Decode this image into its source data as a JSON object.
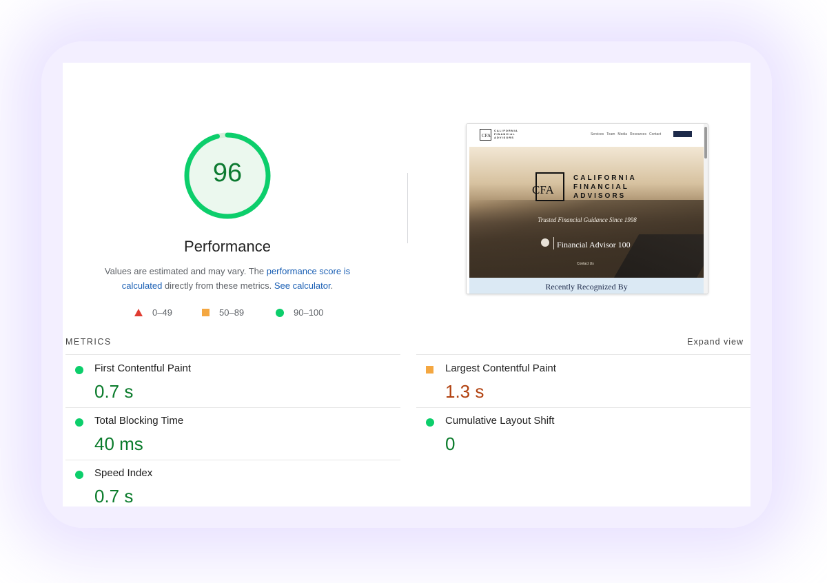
{
  "gauge": {
    "score": "96",
    "score_fraction": 0.96,
    "title": "Performance",
    "color": "#0cce6b"
  },
  "description": {
    "prefix": "Values are estimated and may vary. The ",
    "link1": "performance score is calculated",
    "middle": " directly from these metrics. ",
    "link2": "See calculator",
    "suffix": "."
  },
  "legend": [
    {
      "icon": "triangle-icon",
      "range": "0–49",
      "color": "#e03c31"
    },
    {
      "icon": "square-icon",
      "range": "50–89",
      "color": "#f4a741"
    },
    {
      "icon": "circle-icon",
      "range": "90–100",
      "color": "#0cce6b"
    }
  ],
  "thumbnail": {
    "logo_mark": "CFA",
    "logo_text": "CALIFORNIA\nFINANCIAL\nADVISORS",
    "menu": [
      "Services",
      "Team",
      "Media",
      "Resources",
      "Contact"
    ],
    "hero_logo_mark": "CFA",
    "hero_logo_line1": "CALIFORNIA",
    "hero_logo_line2": "FINANCIAL",
    "hero_logo_line3": "ADVISORS",
    "tagline": "Trusted Financial Guidance Since 1998",
    "award": "Financial Advisor 100",
    "contact": "Contact Us",
    "recognized": "Recently Recognized By"
  },
  "metrics": {
    "title": "METRICS",
    "expand_label": "Expand view",
    "items": [
      {
        "label": "First Contentful Paint",
        "value": "0.7 s",
        "rating": "good"
      },
      {
        "label": "Largest Contentful Paint",
        "value": "1.3 s",
        "rating": "average"
      },
      {
        "label": "Total Blocking Time",
        "value": "40 ms",
        "rating": "good"
      },
      {
        "label": "Cumulative Layout Shift",
        "value": "0",
        "rating": "good"
      },
      {
        "label": "Speed Index",
        "value": "0.7 s",
        "rating": "good"
      }
    ]
  }
}
